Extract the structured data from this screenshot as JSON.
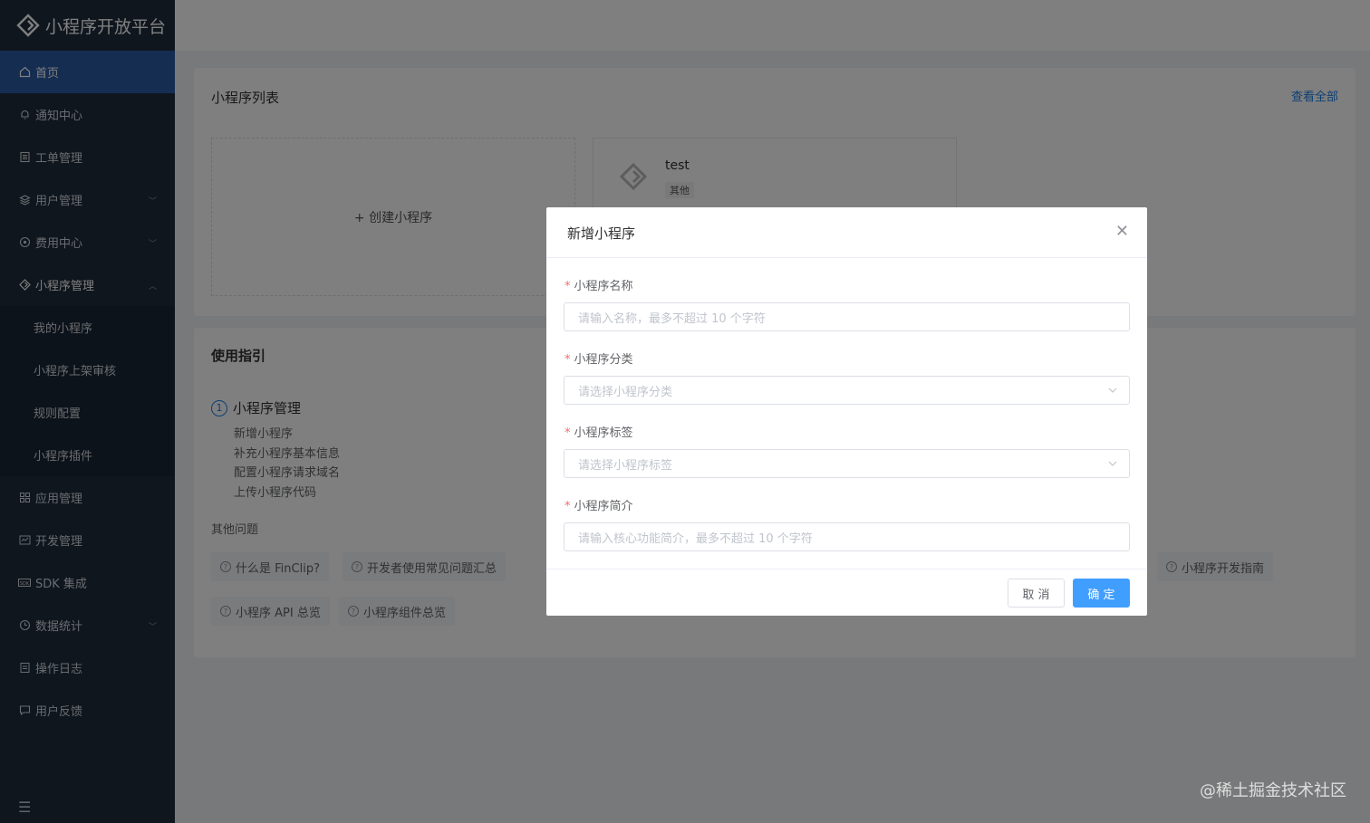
{
  "app": {
    "logo_text": "小程序开放平台"
  },
  "sidebar": {
    "items": [
      {
        "label": "首页",
        "icon": "home-icon"
      },
      {
        "label": "通知中心",
        "icon": "bell-icon"
      },
      {
        "label": "工单管理",
        "icon": "ticket-icon"
      },
      {
        "label": "用户管理",
        "icon": "user-group-icon"
      },
      {
        "label": "费用中心",
        "icon": "currency-icon"
      },
      {
        "label": "小程序管理",
        "icon": "miniapp-icon"
      },
      {
        "label": "我的小程序"
      },
      {
        "label": "小程序上架审核"
      },
      {
        "label": "规则配置"
      },
      {
        "label": "小程序插件"
      },
      {
        "label": "应用管理",
        "icon": "grid-icon"
      },
      {
        "label": "开发管理",
        "icon": "code-icon"
      },
      {
        "label": "SDK 集成",
        "icon": "sdk-icon"
      },
      {
        "label": "数据统计",
        "icon": "chart-icon"
      },
      {
        "label": "操作日志",
        "icon": "log-icon"
      },
      {
        "label": "用户反馈",
        "icon": "feedback-icon"
      }
    ]
  },
  "list_card": {
    "title": "小程序列表",
    "view_all": "查看全部",
    "create_label": "+ 创建小程序",
    "apps": [
      {
        "name": "test",
        "tag": "其他"
      }
    ]
  },
  "guide_card": {
    "title": "使用指引",
    "step_number": "1",
    "step_label": "小程序管理",
    "step_items": [
      "新增小程序",
      "补充小程序基本信息",
      "配置小程序请求域名",
      "上传小程序代码"
    ],
    "faq_title": "其他问题",
    "faq_chips": [
      "什么是 FinClip?",
      "开发者使用常见问题汇总",
      "小程序开发指南",
      "小程序 API 总览",
      "小程序组件总览"
    ]
  },
  "modal": {
    "title": "新增小程序",
    "fields": [
      {
        "label": "小程序名称",
        "placeholder": "请输入名称，最多不超过 10 个字符",
        "type": "input"
      },
      {
        "label": "小程序分类",
        "placeholder": "请选择小程序分类",
        "type": "select"
      },
      {
        "label": "小程序标签",
        "placeholder": "请选择小程序标签",
        "type": "select"
      },
      {
        "label": "小程序简介",
        "placeholder": "请输入核心功能简介，最多不超过 10 个字符",
        "type": "input"
      }
    ],
    "cancel_label": "取 消",
    "ok_label": "确 定"
  },
  "watermark": "@稀土掘金技术社区",
  "colors": {
    "sidebar_bg": "#1f2d3d",
    "active_nav": "#2d5aa5",
    "primary": "#409eff",
    "link": "#1a7ee6",
    "required": "#f56c6c"
  }
}
